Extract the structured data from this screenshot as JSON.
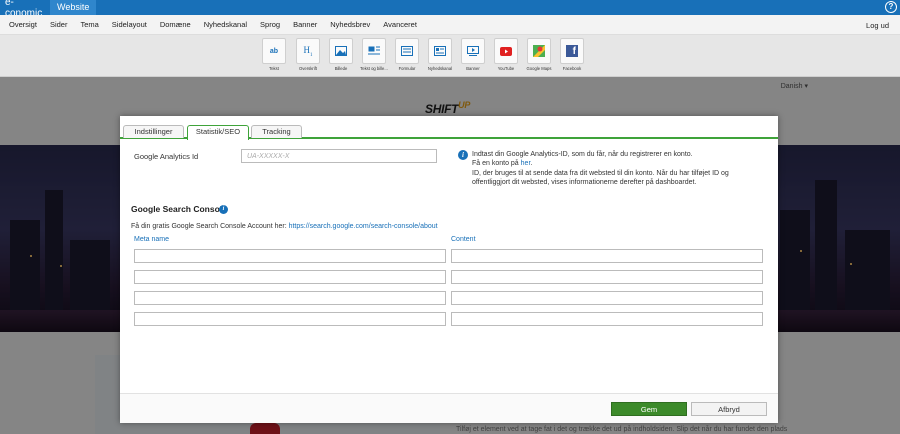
{
  "topbar": {
    "brand": "e-conomic",
    "active_tab": "Website"
  },
  "menu": {
    "items": [
      "Oversigt",
      "Sider",
      "Tema",
      "Sidelayout",
      "Domæne",
      "Nyhedskanal",
      "Sprog",
      "Banner",
      "Nyhedsbrev",
      "Avanceret"
    ],
    "logout": "Log ud"
  },
  "widgets": [
    {
      "label": "Tekst",
      "icon": "text-icon"
    },
    {
      "label": "Overskrift",
      "icon": "heading-icon"
    },
    {
      "label": "Billede",
      "icon": "image-icon"
    },
    {
      "label": "Tekst og bille...",
      "icon": "text-image-icon"
    },
    {
      "label": "Formular",
      "icon": "form-icon"
    },
    {
      "label": "Nyhedskanal",
      "icon": "newsfeed-icon"
    },
    {
      "label": "Banner",
      "icon": "banner-icon"
    },
    {
      "label": "YouTube",
      "icon": "youtube-icon"
    },
    {
      "label": "Google Maps",
      "icon": "maps-icon"
    },
    {
      "label": "Facebook",
      "icon": "facebook-icon"
    }
  ],
  "page": {
    "language": "Danish",
    "logo_main": "SHIFT",
    "logo_accent": "UP",
    "content_text": "Tilføj et element ved at tage fat i det og trække det ud på indholdsiden. Slip det når du har fundet den plads"
  },
  "dialog": {
    "tabs": [
      "Indstillinger",
      "Statistik/SEO",
      "Tracking"
    ],
    "active_tab": "Statistik/SEO",
    "ga_label": "Google Analytics Id",
    "ga_placeholder": "UA-XXXXX-X",
    "ga_value": "",
    "info_line1": "Indtast din Google Analytics-ID, som du får, når du registrerer en konto.",
    "info_line2_prefix": "Få en konto på ",
    "info_line2_link": "her",
    "info_line2_suffix": ".",
    "info_line3": "ID, der bruges til at sende data fra dit websted til din konto. Når du har tilføjet ID og offentliggjort dit websted, vises informationerne derefter på dashboardet.",
    "gsc_title": "Google Search Console",
    "gsc_sub_prefix": "Få din gratis Google Search Console Account her: ",
    "gsc_link": "https://search.google.com/search-console/about",
    "col_meta": "Meta name",
    "col_content": "Content",
    "rows": [
      {
        "meta": "",
        "content": ""
      },
      {
        "meta": "",
        "content": ""
      },
      {
        "meta": "",
        "content": ""
      },
      {
        "meta": "",
        "content": ""
      }
    ],
    "save": "Gem",
    "cancel": "Afbryd"
  },
  "colors": {
    "brand": "#1870b8",
    "save": "#3c8a2a",
    "active_tab_border": "#3fa33a"
  }
}
